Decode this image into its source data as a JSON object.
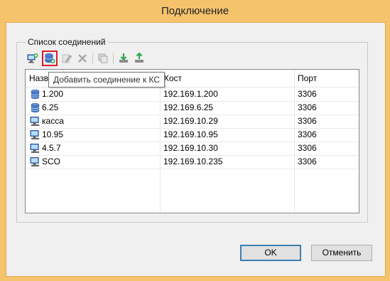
{
  "window": {
    "title": "Подключение"
  },
  "group": {
    "label": "Список соединений"
  },
  "toolbar": {
    "buttons": [
      {
        "icon": "add-connection-icon"
      },
      {
        "icon": "add-db-connection-icon",
        "active": true
      },
      {
        "icon": "edit-icon"
      },
      {
        "icon": "delete-icon"
      },
      {
        "icon": "copy-icon"
      },
      {
        "icon": "import-icon"
      },
      {
        "icon": "export-icon"
      }
    ]
  },
  "tooltip": {
    "text": "Добавить соединение к КС"
  },
  "table": {
    "headers": {
      "name": "Назв",
      "host": "Хост",
      "port": "Порт"
    },
    "rows": [
      {
        "icon": "database-icon",
        "name": "1.200",
        "host": "192.169.1.200",
        "port": "3306"
      },
      {
        "icon": "database-icon",
        "name": "6.25",
        "host": "192.169.6.25",
        "port": "3306"
      },
      {
        "icon": "computer-icon",
        "name": "касса",
        "host": "192.169.10.29",
        "port": "3306"
      },
      {
        "icon": "computer-icon",
        "name": "10.95",
        "host": "192.169.10.95",
        "port": "3306"
      },
      {
        "icon": "computer-icon",
        "name": "4.5.7",
        "host": "192.169.10.30",
        "port": "3306"
      },
      {
        "icon": "computer-icon",
        "name": "SCO",
        "host": "192.169.10.235",
        "port": "3306"
      }
    ]
  },
  "buttons": {
    "ok": "OK",
    "cancel": "Отменить"
  }
}
